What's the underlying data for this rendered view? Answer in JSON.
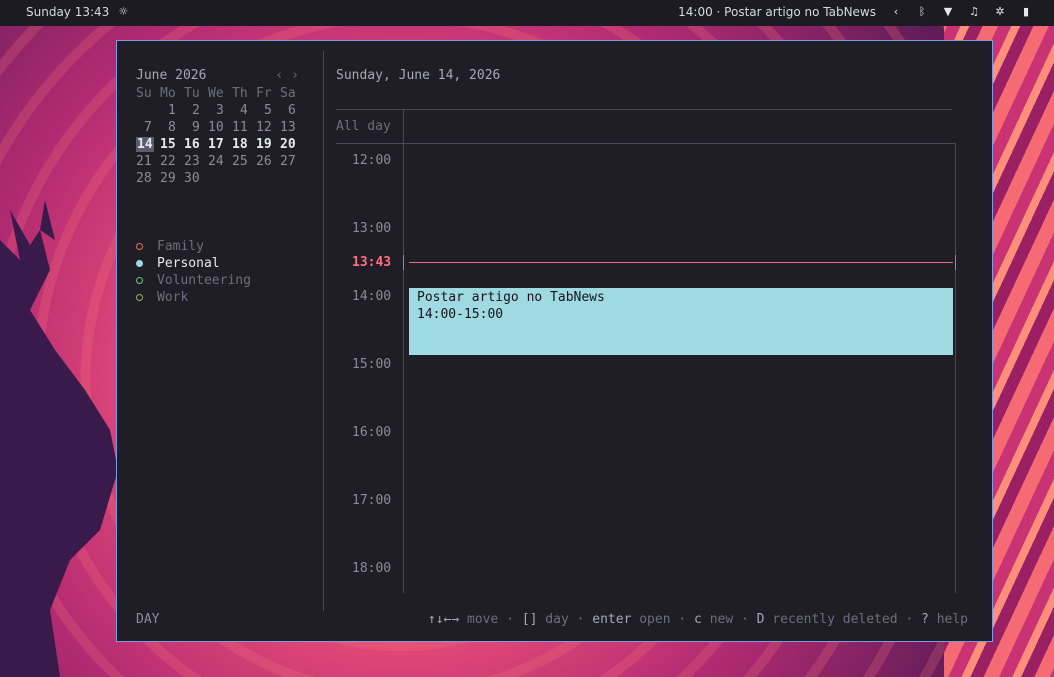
{
  "topbar": {
    "datetime": "Sunday 13:43",
    "weather_icon": "cloud-sun-icon",
    "upcoming_event": "14:00 · Postar artigo no TabNews",
    "tray_icons": [
      "chevron-left-icon",
      "bluetooth-icon",
      "wifi-icon",
      "headphones-icon",
      "settings-icon",
      "battery-icon"
    ]
  },
  "sidebar": {
    "month_title": "June 2026",
    "prev": "‹",
    "next": "›",
    "weekday_headers": [
      "Su",
      "Mo",
      "Tu",
      "We",
      "Th",
      "Fr",
      "Sa"
    ],
    "weeks": [
      [
        "",
        "1",
        "2",
        "3",
        "4",
        "5",
        "6"
      ],
      [
        "7",
        "8",
        "9",
        "10",
        "11",
        "12",
        "13"
      ],
      [
        "14",
        "15",
        "16",
        "17",
        "18",
        "19",
        "20"
      ],
      [
        "21",
        "22",
        "23",
        "24",
        "25",
        "26",
        "27"
      ],
      [
        "28",
        "29",
        "30",
        "",
        "",
        "",
        ""
      ]
    ],
    "today": "14",
    "calendars": [
      {
        "name": "Family",
        "color": "#e0724f",
        "filled": false,
        "active": false
      },
      {
        "name": "Personal",
        "color": "#9fd9e1",
        "filled": true,
        "active": true
      },
      {
        "name": "Volunteering",
        "color": "#6fc27d",
        "filled": false,
        "active": false
      },
      {
        "name": "Work",
        "color": "#8fb86a",
        "filled": false,
        "active": false
      }
    ]
  },
  "main": {
    "date_title": "Sunday, June 14, 2026",
    "all_day_label": "All day",
    "hours": [
      "12:00",
      "13:00",
      "14:00",
      "15:00",
      "16:00",
      "17:00",
      "18:00"
    ],
    "now_label": "13:43",
    "event": {
      "title": "Postar artigo no TabNews",
      "time": "14:00-15:00",
      "color": "#9fd9e1"
    }
  },
  "footer": {
    "mode": "DAY",
    "help": [
      {
        "key": "↑↓←→",
        "label": "move"
      },
      {
        "key": "[]",
        "label": "day"
      },
      {
        "key": "enter",
        "label": "open"
      },
      {
        "key": "c",
        "label": "new"
      },
      {
        "key": "D",
        "label": "recently deleted"
      },
      {
        "key": "?",
        "label": "help"
      }
    ]
  }
}
